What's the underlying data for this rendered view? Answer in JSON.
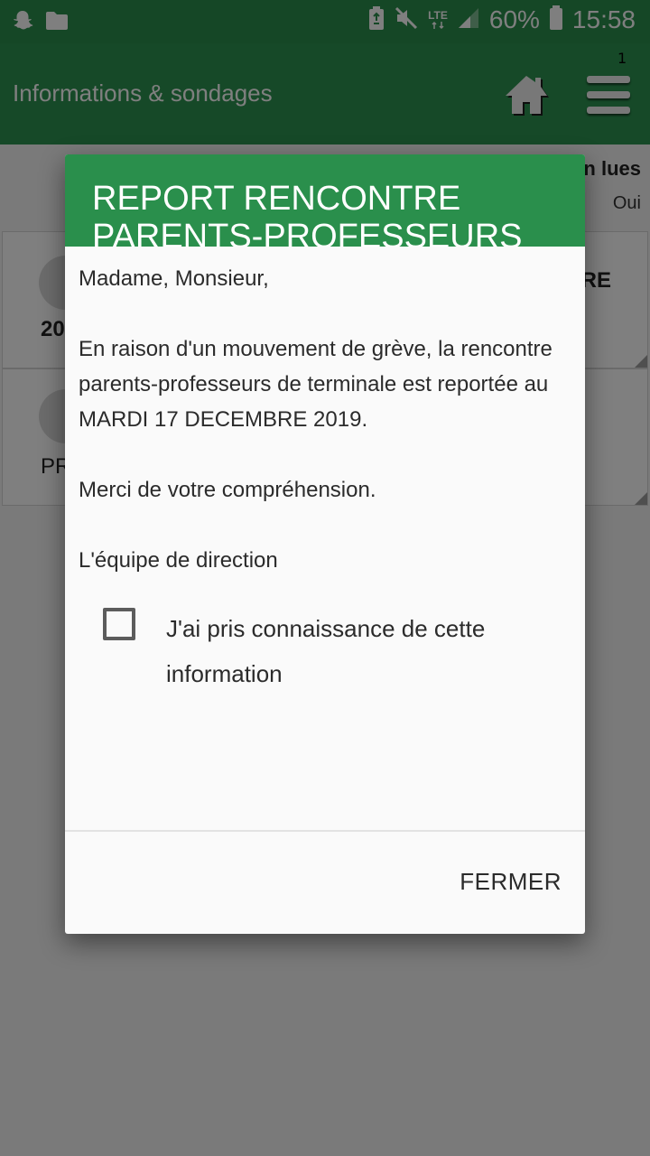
{
  "status_bar": {
    "battery_percent": "60%",
    "time": "15:58",
    "network": "LTE",
    "icons": [
      "snapchat-icon",
      "folder-icon",
      "battery-saver-icon",
      "mute-icon",
      "signal-icon",
      "battery-icon"
    ]
  },
  "app_bar": {
    "title": "Informations & sondages",
    "notification_count": "1",
    "icons": [
      "home-icon",
      "menu-icon"
    ]
  },
  "background": {
    "filter_label": "n lues",
    "filter_value": "Oui",
    "cards": [
      {
        "left_text": "20",
        "right_text": "RE"
      },
      {
        "left_text": "PR"
      }
    ]
  },
  "dialog": {
    "title": "REPORT RENCONTRE PARENTS-PROFESSEURS",
    "greeting": "Madame, Monsieur,",
    "message": "En raison d'un mouvement de grève, la rencontre parents-professeurs de terminale est reportée au MARDI 17 DECEMBRE 2019.",
    "thanks": "Merci de votre compréhension.",
    "signature": "L'équipe de direction",
    "acknowledge_label": "J'ai pris connaissance de cette information",
    "acknowledge_checked": false,
    "close_label": "FERMER"
  },
  "colors": {
    "status_bar": "#2a8f4c",
    "app_bar": "#2c9350",
    "dialog_header": "#2a8f4c",
    "dialog_background": "#fafafa"
  }
}
